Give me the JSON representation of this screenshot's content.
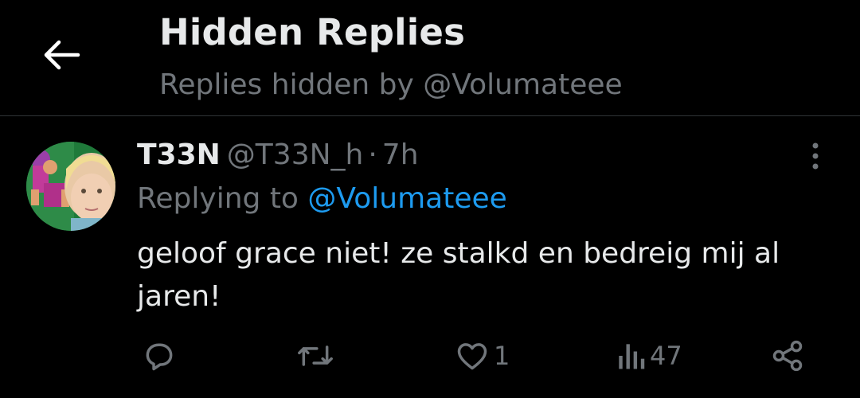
{
  "header": {
    "title": "Hidden Replies",
    "subtitle": "Replies hidden by @Volumateee"
  },
  "tweet": {
    "display_name": "T33N",
    "handle": "@T33N_h",
    "separator": "·",
    "timestamp": "7h",
    "replying_prefix": "Replying to ",
    "replying_to": "@Volumateee",
    "text": "geloof grace niet! ze stalkd en bedreig mij al jaren!",
    "actions": {
      "reply_count": "",
      "retweet_count": "",
      "like_count": "1",
      "views_count": "47"
    }
  },
  "colors": {
    "background": "#000000",
    "primary_text": "#e7e9ea",
    "secondary_text": "#71767b",
    "accent": "#1d9bf0",
    "divider": "#2f3336"
  },
  "icons": {
    "back": "arrow-left-icon",
    "more": "more-vertical-icon",
    "reply": "reply-icon",
    "retweet": "retweet-icon",
    "like": "heart-icon",
    "views": "views-icon",
    "share": "share-icon"
  }
}
